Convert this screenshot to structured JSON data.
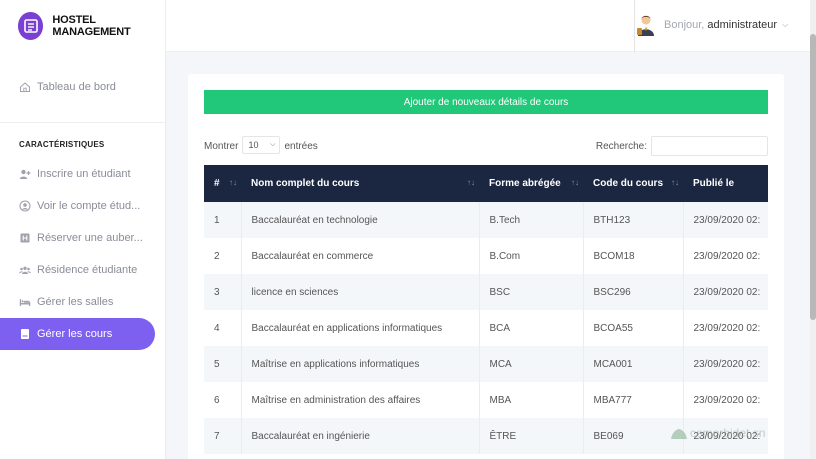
{
  "brand": {
    "title": "HOSTEL MANAGEMENT"
  },
  "sidebar": {
    "dashboard": "Tableau de bord",
    "section_title": "CARACTÉRISTIQUES",
    "items": [
      {
        "label": "Inscrire un étudiant",
        "icon": "user-plus-icon"
      },
      {
        "label": "Voir le compte étud...",
        "icon": "user-circle-icon"
      },
      {
        "label": "Réserver une auber...",
        "icon": "hotel-icon"
      },
      {
        "label": "Résidence étudiante",
        "icon": "users-icon"
      },
      {
        "label": "Gérer les salles",
        "icon": "bed-icon"
      },
      {
        "label": "Gérer les cours",
        "icon": "book-icon",
        "active": true
      }
    ]
  },
  "header": {
    "greeting": "Bonjour,",
    "username": "administrateur"
  },
  "main": {
    "add_button": "Ajouter de nouveaux détails de cours",
    "show_label": "Montrer",
    "page_size": "10",
    "entries_label": "entrées",
    "search_label": "Recherche:",
    "search_value": "",
    "columns": [
      "#",
      "Nom complet du cours",
      "Forme abrégée",
      "Code du cours",
      "Publié le"
    ],
    "rows": [
      [
        "1",
        "Baccalauréat en technologie",
        "B.Tech",
        "BTH123",
        "23/09/2020 02:"
      ],
      [
        "2",
        "Baccalauréat en commerce",
        "B.Com",
        "BCOM18",
        "23/09/2020 02:"
      ],
      [
        "3",
        "licence en sciences",
        "BSC",
        "BSC296",
        "23/09/2020 02:"
      ],
      [
        "4",
        "Baccalauréat en applications informatiques",
        "BCA",
        "BCOA55",
        "23/09/2020 02:"
      ],
      [
        "5",
        "Maîtrise en applications informatiques",
        "MCA",
        "MCA001",
        "23/09/2020 02:"
      ],
      [
        "6",
        "Maîtrise en administration des affaires",
        "MBA",
        "MBA777",
        "23/09/2020 02:"
      ],
      [
        "7",
        "Baccalauréat en ingénierie",
        "ÊTRE",
        "BE069",
        "23/09/2020 02:"
      ]
    ]
  },
  "watermark": "comorbidet.sn",
  "colors": {
    "accent": "#7d60ef",
    "add_button": "#22c879",
    "table_header": "#1b2640",
    "brand_logo": "#7a3fd3"
  }
}
